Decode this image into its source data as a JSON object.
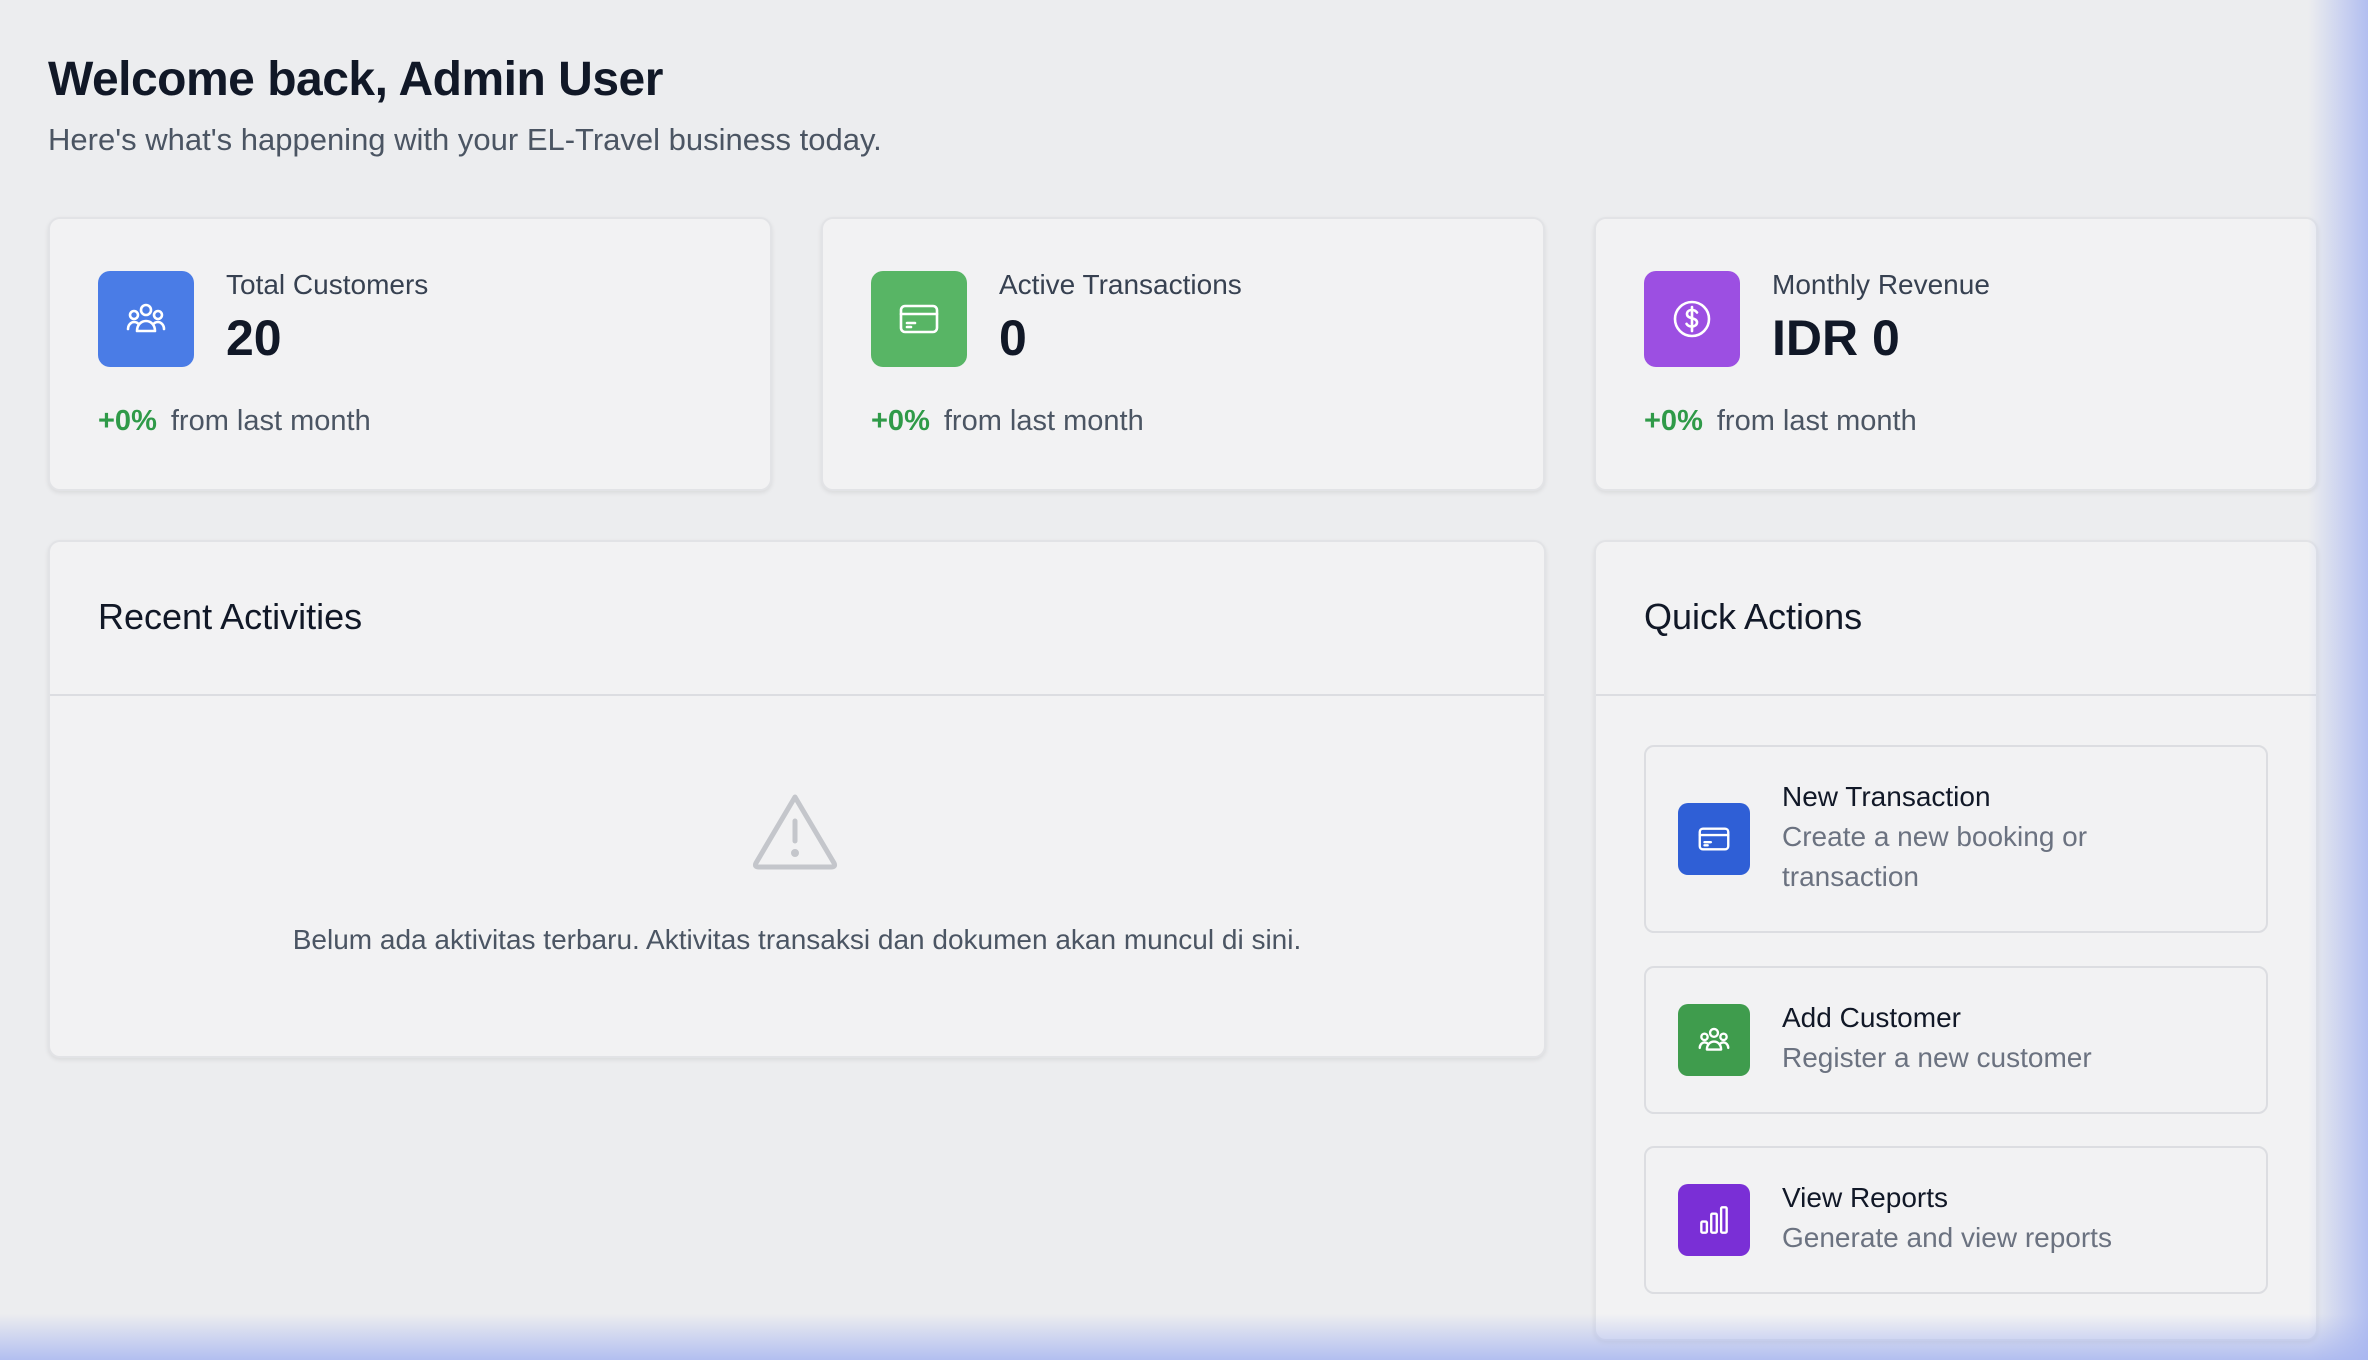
{
  "header": {
    "title": "Welcome back, Admin User",
    "subtitle": "Here's what's happening with your EL-Travel business today."
  },
  "stats": [
    {
      "label": "Total Customers",
      "value": "20",
      "change": "+0%",
      "change_suffix": "from last month",
      "icon": "users-icon",
      "color": "#4a7ce6"
    },
    {
      "label": "Active Transactions",
      "value": "0",
      "change": "+0%",
      "change_suffix": "from last month",
      "icon": "credit-card-icon",
      "color": "#58b565"
    },
    {
      "label": "Monthly Revenue",
      "value": "IDR 0",
      "change": "+0%",
      "change_suffix": "from last month",
      "icon": "dollar-icon",
      "color": "#9c4fe2"
    }
  ],
  "recent_activities": {
    "title": "Recent Activities",
    "empty_message": "Belum ada aktivitas terbaru. Aktivitas transaksi dan dokumen akan muncul di sini.",
    "icon": "warning-icon"
  },
  "quick_actions": {
    "title": "Quick Actions",
    "items": [
      {
        "title": "New Transaction",
        "description": "Create a new booking or transaction",
        "icon": "credit-card-icon",
        "color": "#2f5fd6"
      },
      {
        "title": "Add Customer",
        "description": "Register a new customer",
        "icon": "users-icon",
        "color": "#3f9c4d"
      },
      {
        "title": "View Reports",
        "description": "Generate and view reports",
        "icon": "bar-chart-icon",
        "color": "#7a2fd6"
      }
    ]
  },
  "colors": {
    "positive": "#2f9a48",
    "background": "#ecedef"
  }
}
